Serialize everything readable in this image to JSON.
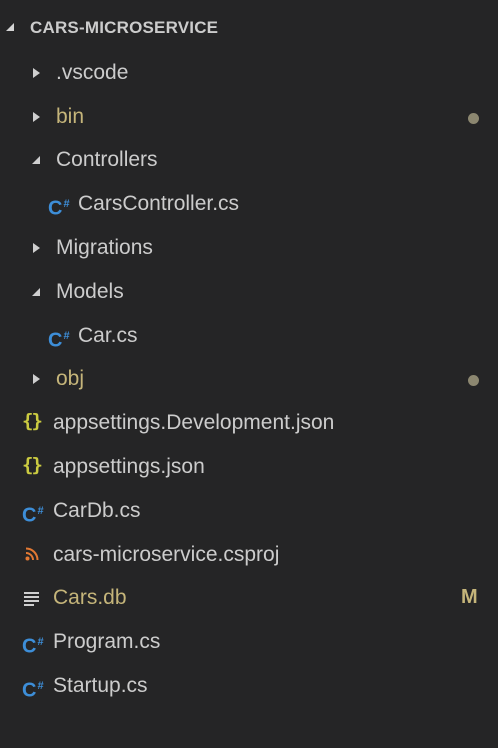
{
  "explorer": {
    "section_title": "CARS-MICROSERVICE",
    "items": [
      {
        "label": ".vscode"
      },
      {
        "label": "bin"
      },
      {
        "label": "Controllers"
      },
      {
        "label": "CarsController.cs"
      },
      {
        "label": "Migrations"
      },
      {
        "label": "Models"
      },
      {
        "label": "Car.cs"
      },
      {
        "label": "obj"
      },
      {
        "label": "appsettings.Development.json"
      },
      {
        "label": "appsettings.json"
      },
      {
        "label": "CarDb.cs"
      },
      {
        "label": "cars-microservice.csproj"
      },
      {
        "label": "Cars.db",
        "git_status": "M"
      },
      {
        "label": "Program.cs"
      },
      {
        "label": "Startup.cs"
      }
    ]
  },
  "icons": {
    "csharp": "C",
    "csharp_hash": "#",
    "json": "{}"
  },
  "colors": {
    "background": "#252526",
    "text": "#cccccc",
    "modified": "#c5b57a",
    "csharp_icon": "#3d8ed8",
    "json_icon": "#cbcb41",
    "rss_icon": "#e37933",
    "dot": "#8c8770"
  }
}
